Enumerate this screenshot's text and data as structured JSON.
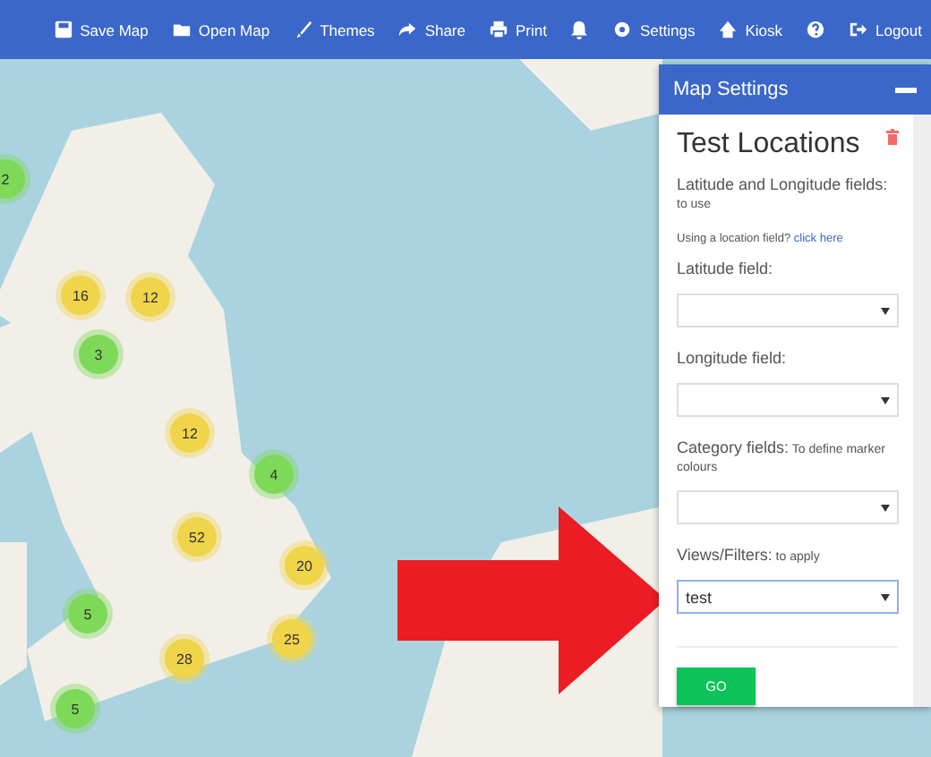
{
  "navbar": {
    "items": [
      {
        "kind": "text",
        "label": "Save Map"
      },
      {
        "kind": "text",
        "label": "Open Map"
      },
      {
        "kind": "text",
        "label": "Themes"
      },
      {
        "kind": "text",
        "label": "Share"
      },
      {
        "kind": "text",
        "label": "Print"
      },
      {
        "kind": "icon"
      },
      {
        "kind": "text",
        "label": "Settings"
      },
      {
        "kind": "text",
        "label": "Kiosk"
      },
      {
        "kind": "icon"
      },
      {
        "kind": "text",
        "label": "Logout"
      }
    ]
  },
  "map": {
    "clusters": [
      {
        "count": "2",
        "color": "#7ed957"
      },
      {
        "count": "16",
        "color": "#f0d44a"
      },
      {
        "count": "12",
        "color": "#f0d44a"
      },
      {
        "count": "3",
        "color": "#7ed957"
      },
      {
        "count": "12",
        "color": "#f0d44a"
      },
      {
        "count": "4",
        "color": "#7ed957"
      },
      {
        "count": "52",
        "color": "#f0d44a"
      },
      {
        "count": "20",
        "color": "#f0d44a"
      },
      {
        "count": "5",
        "color": "#7ed957"
      },
      {
        "count": "25",
        "color": "#f0d44a"
      },
      {
        "count": "28",
        "color": "#f0d44a"
      },
      {
        "count": "5",
        "color": "#7ed957"
      }
    ]
  },
  "panel": {
    "title": "Map Settings",
    "heading": "Test Locations",
    "fields": [
      {
        "kind": "section",
        "label": "Latitude and Longitude fields:",
        "hint": "to use"
      },
      {
        "kind": "note",
        "text": "Using a location field?",
        "link": "click here"
      },
      {
        "kind": "select",
        "label": "Latitude field:",
        "focused": false
      },
      {
        "kind": "select",
        "label": "Longitude field:",
        "focused": false
      },
      {
        "kind": "select",
        "label": "Category fields:",
        "hint": "To define marker colours",
        "focused": false
      },
      {
        "kind": "select",
        "label": "Views/Filters:",
        "hint": "to apply",
        "value": "test",
        "focused": true
      }
    ],
    "button": "GO"
  }
}
